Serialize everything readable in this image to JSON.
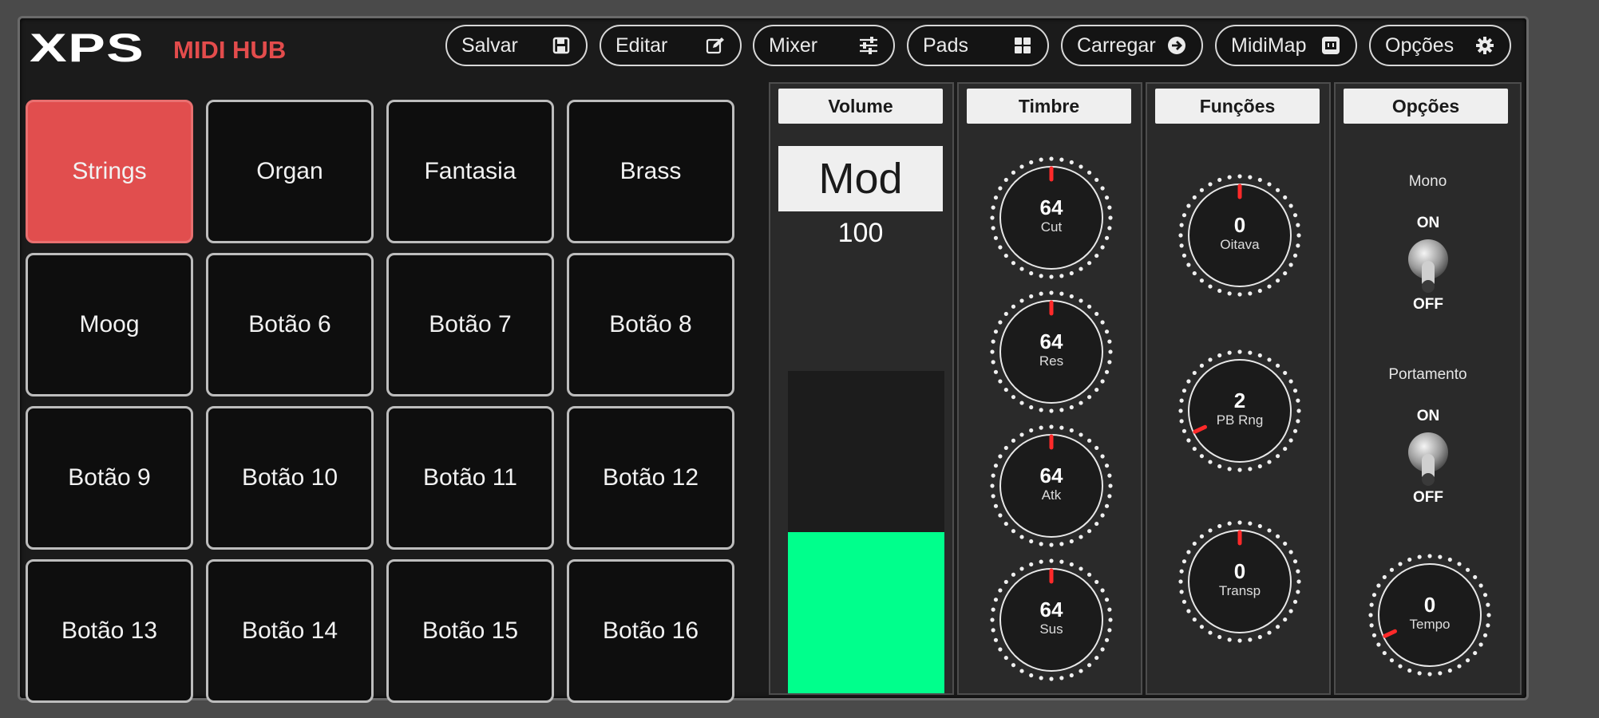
{
  "header": {
    "logo_main": "XPS",
    "logo_sub": "MIDI HUB",
    "buttons": [
      {
        "label": "Salvar",
        "icon": "save-icon"
      },
      {
        "label": "Editar",
        "icon": "edit-icon"
      },
      {
        "label": "Mixer",
        "icon": "sliders-icon"
      },
      {
        "label": "Pads",
        "icon": "grid-icon"
      },
      {
        "label": "Carregar",
        "icon": "arrow-right-circle-icon"
      },
      {
        "label": "MidiMap",
        "icon": "midi-icon"
      },
      {
        "label": "Opções",
        "icon": "gear-icon"
      }
    ]
  },
  "pads": [
    "Strings",
    "Organ",
    "Fantasia",
    "Brass",
    "Moog",
    "Botão 6",
    "Botão 7",
    "Botão 8",
    "Botão 9",
    "Botão 10",
    "Botão 11",
    "Botão 12",
    "Botão 13",
    "Botão 14",
    "Botão 15",
    "Botão 16"
  ],
  "active_pad": "Strings",
  "columns": {
    "volume": {
      "title": "Volume",
      "mod_label": "Mod",
      "mod_value": "100",
      "fader_level": 0.5
    },
    "timbre": {
      "title": "Timbre",
      "knobs": [
        {
          "value": "64",
          "label": "Cut"
        },
        {
          "value": "64",
          "label": "Res"
        },
        {
          "value": "64",
          "label": "Atk"
        },
        {
          "value": "64",
          "label": "Sus"
        }
      ]
    },
    "funcoes": {
      "title": "Funções",
      "knobs": [
        {
          "value": "0",
          "label": "Oitava"
        },
        {
          "value": "2",
          "label": "PB Rng"
        },
        {
          "value": "0",
          "label": "Transp"
        }
      ]
    },
    "opcoes": {
      "title": "Opções",
      "mono_label": "Mono",
      "portamento_label": "Portamento",
      "toggle_on": "ON",
      "toggle_off": "OFF",
      "tempo": {
        "value": "0",
        "label": "Tempo"
      }
    }
  },
  "colors": {
    "accent": "#e34c4c",
    "fader": "#00ff8c",
    "pad_active": "#e14e4e"
  }
}
